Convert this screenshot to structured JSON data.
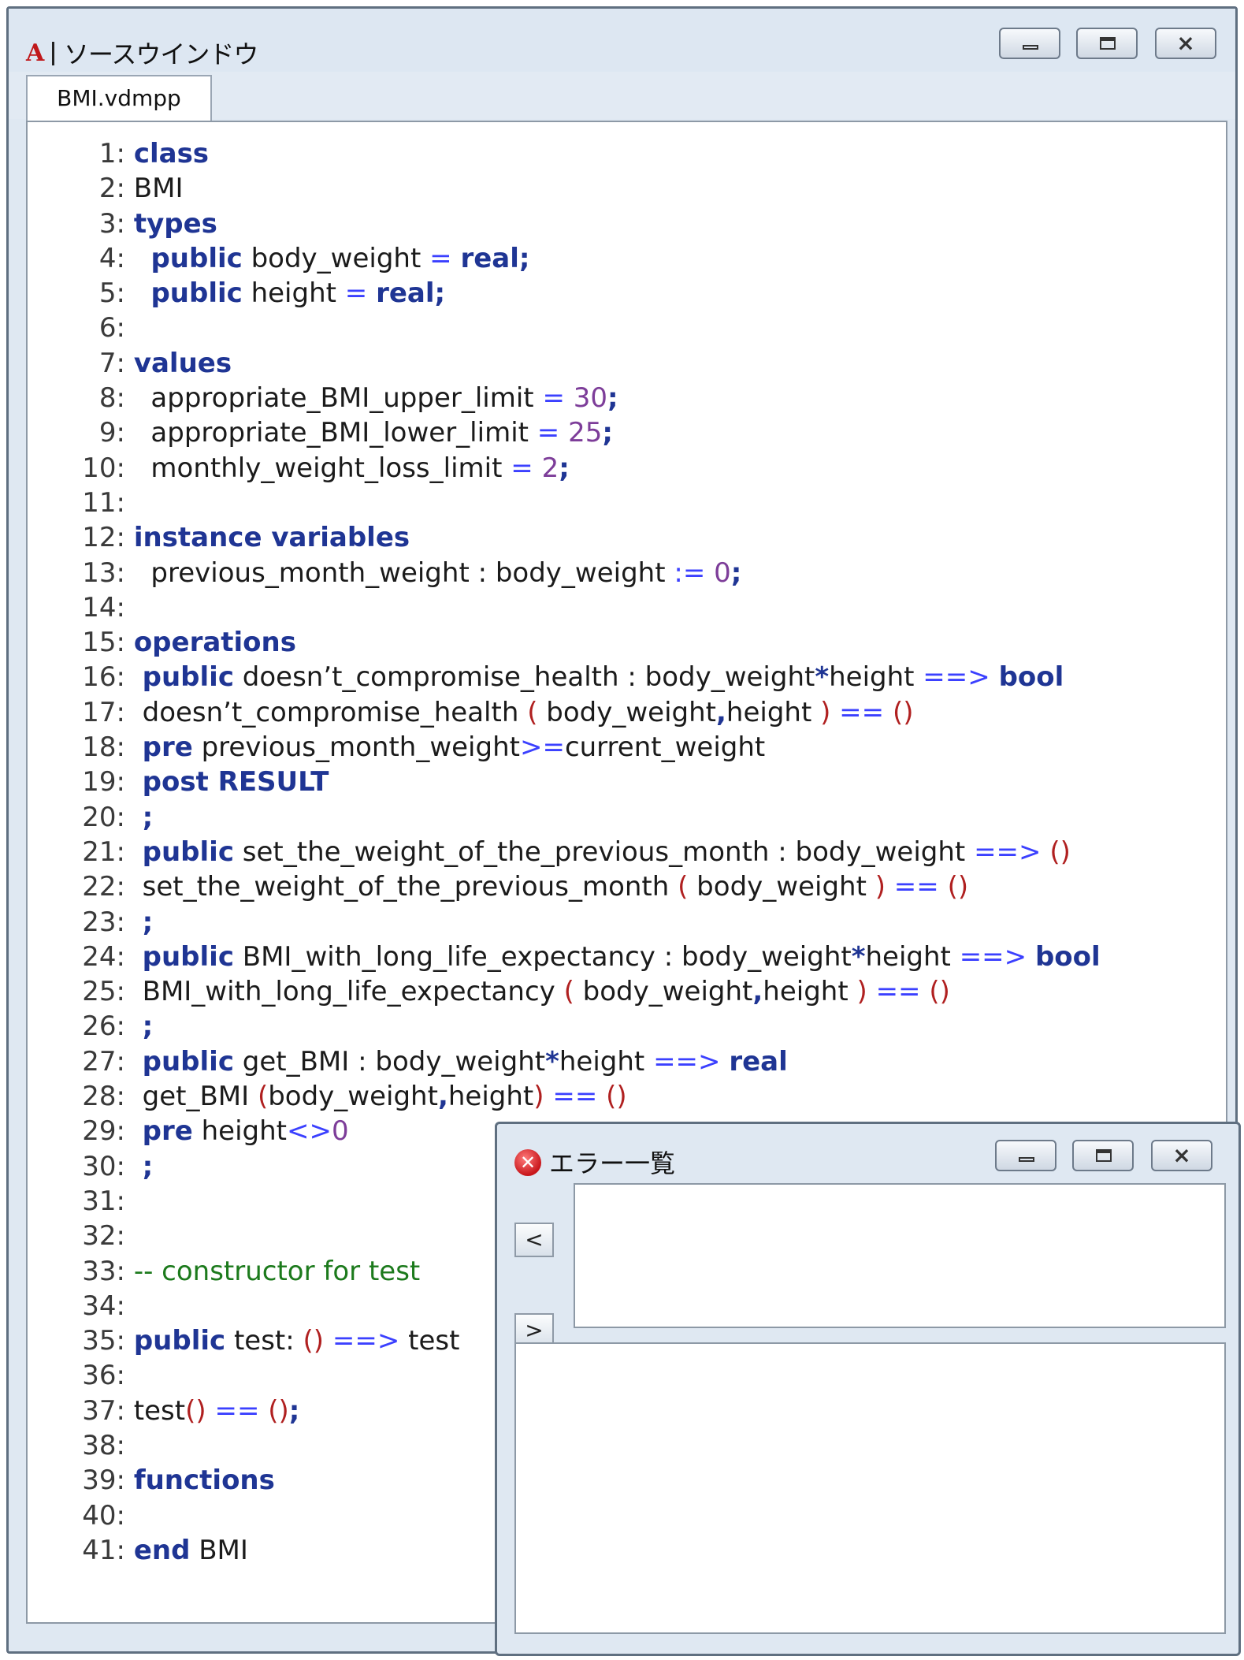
{
  "source_window": {
    "title": "ソースウインドウ",
    "app_icon_letter": "A",
    "tab_label": "BMI.vdmpp",
    "buttons": {
      "minimize": "minimize",
      "maximize": "maximize",
      "close": "close"
    }
  },
  "editor": {
    "lines": [
      {
        "n": "1:",
        "segs": [
          {
            "t": " "
          },
          {
            "t": "class",
            "c": "kw"
          }
        ]
      },
      {
        "n": "2:",
        "segs": [
          {
            "t": " BMI"
          }
        ]
      },
      {
        "n": "3:",
        "segs": [
          {
            "t": " "
          },
          {
            "t": "types",
            "c": "kw"
          }
        ]
      },
      {
        "n": "4:",
        "segs": [
          {
            "t": "   "
          },
          {
            "t": "public",
            "c": "kw"
          },
          {
            "t": " body_weight "
          },
          {
            "t": "=",
            "c": "op"
          },
          {
            "t": " "
          },
          {
            "t": "real;",
            "c": "kw"
          }
        ]
      },
      {
        "n": "5:",
        "segs": [
          {
            "t": "   "
          },
          {
            "t": "public",
            "c": "kw"
          },
          {
            "t": " height "
          },
          {
            "t": "=",
            "c": "op"
          },
          {
            "t": " "
          },
          {
            "t": "real;",
            "c": "kw"
          }
        ]
      },
      {
        "n": "6:",
        "segs": []
      },
      {
        "n": "7:",
        "segs": [
          {
            "t": " "
          },
          {
            "t": "values",
            "c": "kw"
          }
        ]
      },
      {
        "n": "8:",
        "segs": [
          {
            "t": "   appropriate_BMI_upper_limit "
          },
          {
            "t": "=",
            "c": "op"
          },
          {
            "t": " "
          },
          {
            "t": "30",
            "c": "num"
          },
          {
            "t": ";",
            "c": "kw"
          }
        ]
      },
      {
        "n": "9:",
        "segs": [
          {
            "t": "   appropriate_BMI_lower_limit "
          },
          {
            "t": "=",
            "c": "op"
          },
          {
            "t": " "
          },
          {
            "t": "25",
            "c": "num"
          },
          {
            "t": ";",
            "c": "kw"
          }
        ]
      },
      {
        "n": "10:",
        "segs": [
          {
            "t": "   monthly_weight_loss_limit "
          },
          {
            "t": "=",
            "c": "op"
          },
          {
            "t": " "
          },
          {
            "t": "2",
            "c": "num"
          },
          {
            "t": ";",
            "c": "kw"
          }
        ]
      },
      {
        "n": "11:",
        "segs": []
      },
      {
        "n": "12:",
        "segs": [
          {
            "t": " "
          },
          {
            "t": "instance variables",
            "c": "kw"
          }
        ]
      },
      {
        "n": "13:",
        "segs": [
          {
            "t": "   previous_month_weight : body_weight "
          },
          {
            "t": ":=",
            "c": "op"
          },
          {
            "t": " "
          },
          {
            "t": "0",
            "c": "num"
          },
          {
            "t": ";",
            "c": "kw"
          }
        ]
      },
      {
        "n": "14:",
        "segs": []
      },
      {
        "n": "15:",
        "segs": [
          {
            "t": " "
          },
          {
            "t": "operations",
            "c": "kw"
          }
        ]
      },
      {
        "n": "16:",
        "segs": [
          {
            "t": "  "
          },
          {
            "t": "public",
            "c": "kw"
          },
          {
            "t": " doesn’t_compromise_health : body_weight"
          },
          {
            "t": "*",
            "c": "kw"
          },
          {
            "t": "height "
          },
          {
            "t": "==>",
            "c": "op"
          },
          {
            "t": " "
          },
          {
            "t": "bool",
            "c": "kw"
          }
        ]
      },
      {
        "n": "17:",
        "segs": [
          {
            "t": "  doesn’t_compromise_health "
          },
          {
            "t": "(",
            "c": "par"
          },
          {
            "t": " body_weight"
          },
          {
            "t": ",",
            "c": "kw"
          },
          {
            "t": "height "
          },
          {
            "t": ")",
            "c": "par"
          },
          {
            "t": " "
          },
          {
            "t": "==",
            "c": "op"
          },
          {
            "t": " "
          },
          {
            "t": "()",
            "c": "par"
          }
        ]
      },
      {
        "n": "18:",
        "segs": [
          {
            "t": "  "
          },
          {
            "t": "pre",
            "c": "kw"
          },
          {
            "t": " previous_month_weight"
          },
          {
            "t": ">=",
            "c": "op"
          },
          {
            "t": "current_weight"
          }
        ]
      },
      {
        "n": "19:",
        "segs": [
          {
            "t": "  "
          },
          {
            "t": "post RESULT",
            "c": "kw"
          }
        ]
      },
      {
        "n": "20:",
        "segs": [
          {
            "t": "  "
          },
          {
            "t": ";",
            "c": "kw"
          }
        ]
      },
      {
        "n": "21:",
        "segs": [
          {
            "t": "  "
          },
          {
            "t": "public",
            "c": "kw"
          },
          {
            "t": " set_the_weight_of_the_previous_month : body_weight "
          },
          {
            "t": "==>",
            "c": "op"
          },
          {
            "t": " "
          },
          {
            "t": "()",
            "c": "par"
          }
        ]
      },
      {
        "n": "22:",
        "segs": [
          {
            "t": "  set_the_weight_of_the_previous_month "
          },
          {
            "t": "(",
            "c": "par"
          },
          {
            "t": " body_weight "
          },
          {
            "t": ")",
            "c": "par"
          },
          {
            "t": " "
          },
          {
            "t": "==",
            "c": "op"
          },
          {
            "t": " "
          },
          {
            "t": "()",
            "c": "par"
          }
        ]
      },
      {
        "n": "23:",
        "segs": [
          {
            "t": "  "
          },
          {
            "t": ";",
            "c": "kw"
          }
        ]
      },
      {
        "n": "24:",
        "segs": [
          {
            "t": "  "
          },
          {
            "t": "public",
            "c": "kw"
          },
          {
            "t": " BMI_with_long_life_expectancy : body_weight"
          },
          {
            "t": "*",
            "c": "kw"
          },
          {
            "t": "height "
          },
          {
            "t": "==>",
            "c": "op"
          },
          {
            "t": " "
          },
          {
            "t": "bool",
            "c": "kw"
          }
        ]
      },
      {
        "n": "25:",
        "segs": [
          {
            "t": "  BMI_with_long_life_expectancy "
          },
          {
            "t": "(",
            "c": "par"
          },
          {
            "t": " body_weight"
          },
          {
            "t": ",",
            "c": "kw"
          },
          {
            "t": "height "
          },
          {
            "t": ")",
            "c": "par"
          },
          {
            "t": " "
          },
          {
            "t": "==",
            "c": "op"
          },
          {
            "t": " "
          },
          {
            "t": "()",
            "c": "par"
          }
        ]
      },
      {
        "n": "26:",
        "segs": [
          {
            "t": "  "
          },
          {
            "t": ";",
            "c": "kw"
          }
        ]
      },
      {
        "n": "27:",
        "segs": [
          {
            "t": "  "
          },
          {
            "t": "public",
            "c": "kw"
          },
          {
            "t": " get_BMI : body_weight"
          },
          {
            "t": "*",
            "c": "kw"
          },
          {
            "t": "height "
          },
          {
            "t": "==>",
            "c": "op"
          },
          {
            "t": " "
          },
          {
            "t": "real",
            "c": "kw"
          }
        ]
      },
      {
        "n": "28:",
        "segs": [
          {
            "t": "  get_BMI "
          },
          {
            "t": "(",
            "c": "par"
          },
          {
            "t": "body_weight"
          },
          {
            "t": ",",
            "c": "kw"
          },
          {
            "t": "height"
          },
          {
            "t": ")",
            "c": "par"
          },
          {
            "t": " "
          },
          {
            "t": "==",
            "c": "op"
          },
          {
            "t": " "
          },
          {
            "t": "()",
            "c": "par"
          }
        ]
      },
      {
        "n": "29:",
        "segs": [
          {
            "t": "  "
          },
          {
            "t": "pre",
            "c": "kw"
          },
          {
            "t": " height"
          },
          {
            "t": "<>",
            "c": "op"
          },
          {
            "t": "0",
            "c": "num"
          }
        ]
      },
      {
        "n": "30:",
        "segs": [
          {
            "t": "  "
          },
          {
            "t": ";",
            "c": "kw"
          }
        ]
      },
      {
        "n": "31:",
        "segs": []
      },
      {
        "n": "32:",
        "segs": []
      },
      {
        "n": "33:",
        "segs": [
          {
            "t": " "
          },
          {
            "t": "-- constructor for test",
            "c": "cmt"
          }
        ]
      },
      {
        "n": "34:",
        "segs": []
      },
      {
        "n": "35:",
        "segs": [
          {
            "t": " "
          },
          {
            "t": "public",
            "c": "kw"
          },
          {
            "t": " test: "
          },
          {
            "t": "()",
            "c": "par"
          },
          {
            "t": " "
          },
          {
            "t": "==>",
            "c": "op"
          },
          {
            "t": " test"
          }
        ]
      },
      {
        "n": "36:",
        "segs": []
      },
      {
        "n": "37:",
        "segs": [
          {
            "t": " test"
          },
          {
            "t": "()",
            "c": "par"
          },
          {
            "t": " "
          },
          {
            "t": "==",
            "c": "op"
          },
          {
            "t": " "
          },
          {
            "t": "()",
            "c": "par"
          },
          {
            "t": ";",
            "c": "kw"
          }
        ]
      },
      {
        "n": "38:",
        "segs": []
      },
      {
        "n": "39:",
        "segs": [
          {
            "t": " "
          },
          {
            "t": "functions",
            "c": "kw"
          }
        ]
      },
      {
        "n": "40:",
        "segs": []
      },
      {
        "n": "41:",
        "segs": [
          {
            "t": " "
          },
          {
            "t": "end",
            "c": "kw"
          },
          {
            "t": " BMI"
          }
        ]
      }
    ]
  },
  "error_window": {
    "title": "エラー一覧",
    "error_icon_glyph": "✕",
    "prev_label": "<",
    "next_label": ">"
  },
  "colors": {
    "keyword": "#1f3594",
    "operator": "#3b40ff",
    "number": "#7d3d99",
    "paren": "#b02020",
    "comment": "#1c7a1c"
  },
  "icons": {
    "app": "vdm-app-icon",
    "error": "error-circle-icon",
    "minimize": "minimize-icon",
    "maximize": "maximize-icon",
    "close": "close-icon"
  }
}
